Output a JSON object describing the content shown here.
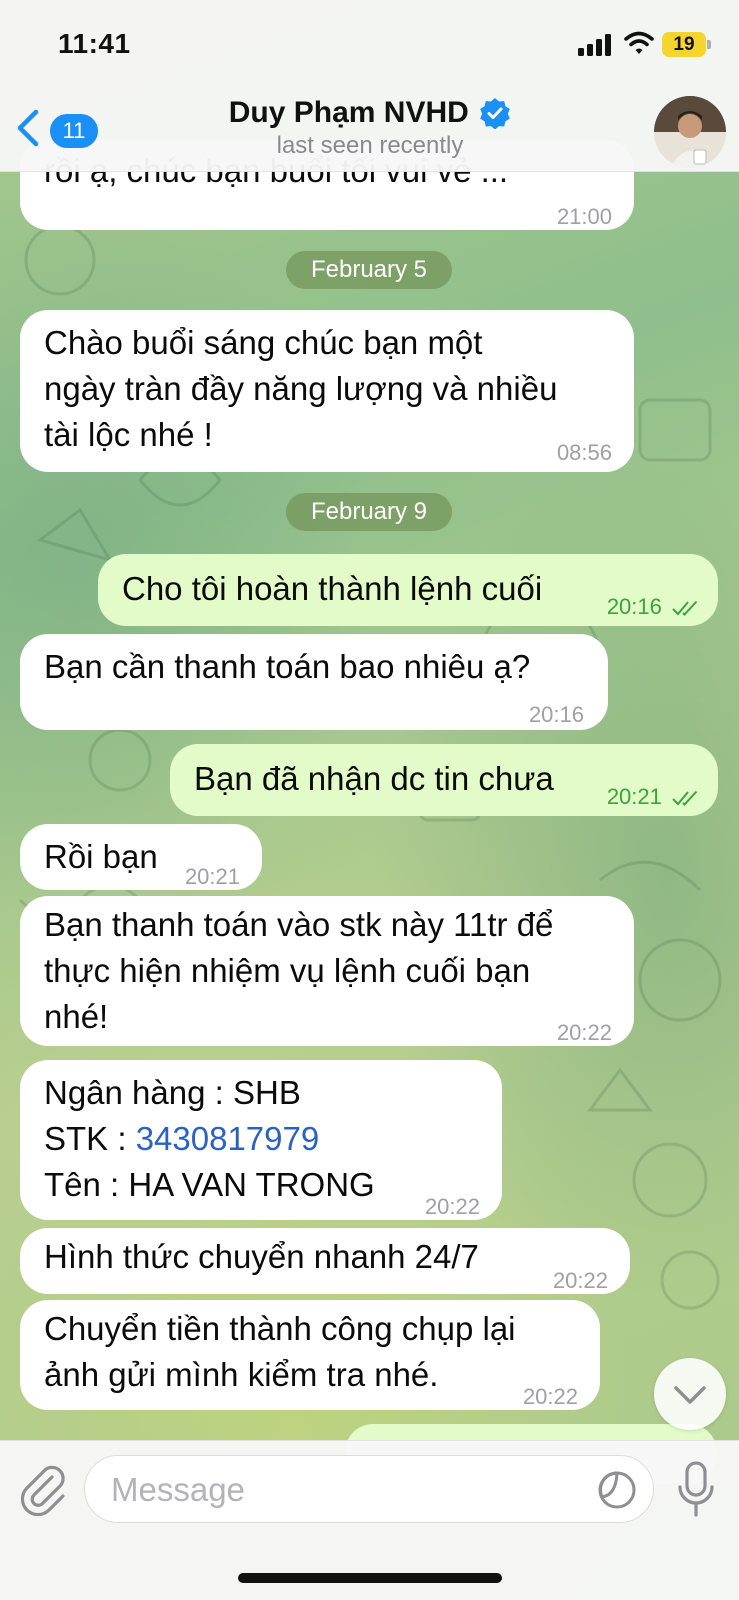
{
  "status_bar": {
    "time": "11:41",
    "battery_level": "19"
  },
  "header": {
    "back_badge": "11",
    "title": "Duy Phạm NVHD",
    "subtitle": "last seen recently"
  },
  "messages": [
    {
      "partial_text": "rồi ạ, chúc bạn buổi tối vui vẻ ...",
      "time": "21:00"
    },
    {
      "date": "February 5"
    },
    {
      "text": "Chào buổi sáng chúc bạn một\nngày tràn đầy năng lượng và nhiều\ntài lộc nhé !",
      "time": "08:56"
    },
    {
      "date": "February 9"
    },
    {
      "text": "Cho tôi hoàn thành lệnh cuối",
      "time": "20:16"
    },
    {
      "text": "Bạn cần thanh toán bao nhiêu ạ?",
      "time": "20:16"
    },
    {
      "text": "Bạn đã nhận dc tin chưa",
      "time": "20:21"
    },
    {
      "text": "Rồi bạn",
      "time": "20:21"
    },
    {
      "text": "Bạn thanh toán vào stk này 11tr để\nthực hiện nhiệm vụ lệnh cuối bạn\nnhé!",
      "time": "20:22"
    },
    {
      "bank_line": "Ngân hàng : SHB",
      "account_label": "STK : ",
      "account_number": "3430817979",
      "name_line": "Tên : HA VAN TRONG",
      "time": "20:22"
    },
    {
      "text": "Hình thức chuyển nhanh 24/7",
      "time": "20:22"
    },
    {
      "text": "Chuyển tiền thành công chụp lại\nảnh gửi mình kiểm tra nhé.",
      "time": "20:22"
    }
  ],
  "input": {
    "placeholder": "Message"
  },
  "colors": {
    "accent": "#1a8ff5",
    "outgoing_bubble": "#e2fbc8",
    "incoming_bubble": "#ffffff",
    "read_tick": "#3ba33a",
    "link": "#2962c4"
  }
}
